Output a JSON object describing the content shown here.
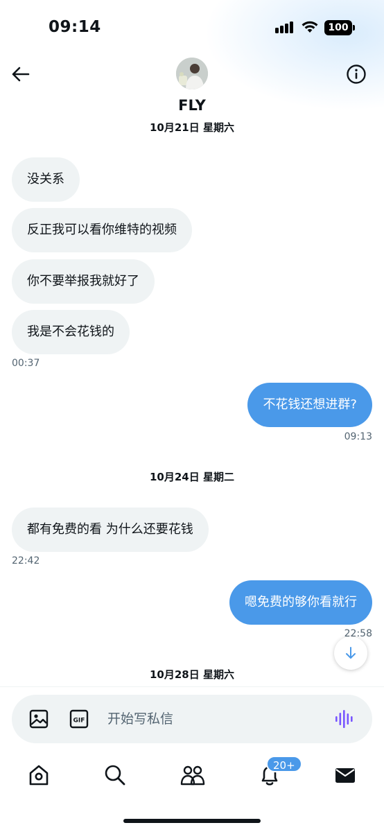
{
  "status_bar": {
    "time": "09:14",
    "battery": "100"
  },
  "header": {
    "contact_name": "FLY"
  },
  "conversation": {
    "dates": [
      "10月21日 星期六",
      "10月24日 星期二",
      "10月28日 星期六"
    ],
    "messages": [
      {
        "direction": "in",
        "text": "没关系"
      },
      {
        "direction": "in",
        "text": "反正我可以看你维特的视频"
      },
      {
        "direction": "in",
        "text": "你不要举报我就好了"
      },
      {
        "direction": "in",
        "text": "我是不会花钱的"
      },
      {
        "direction": "out",
        "text": "不花钱还想进群?"
      },
      {
        "direction": "in",
        "text": "都有免费的看 为什么还要花钱"
      },
      {
        "direction": "out",
        "text": "嗯免费的够你看就行"
      }
    ],
    "timestamps": [
      "00:37",
      "09:13",
      "22:42",
      "22:58"
    ]
  },
  "composer": {
    "placeholder": "开始写私信",
    "gif_label": "GIF"
  },
  "tabbar": {
    "notifications_badge": "20+"
  },
  "colors": {
    "accent": "#4a99e9",
    "incoming_bubble": "#eff3f4",
    "voice_icon": "#7856ff"
  },
  "icons": [
    "back-arrow-icon",
    "info-icon",
    "image-icon",
    "gif-icon",
    "voice-waveform-icon",
    "arrow-down-icon",
    "home-icon",
    "search-icon",
    "communities-icon",
    "bell-icon",
    "mail-icon"
  ]
}
